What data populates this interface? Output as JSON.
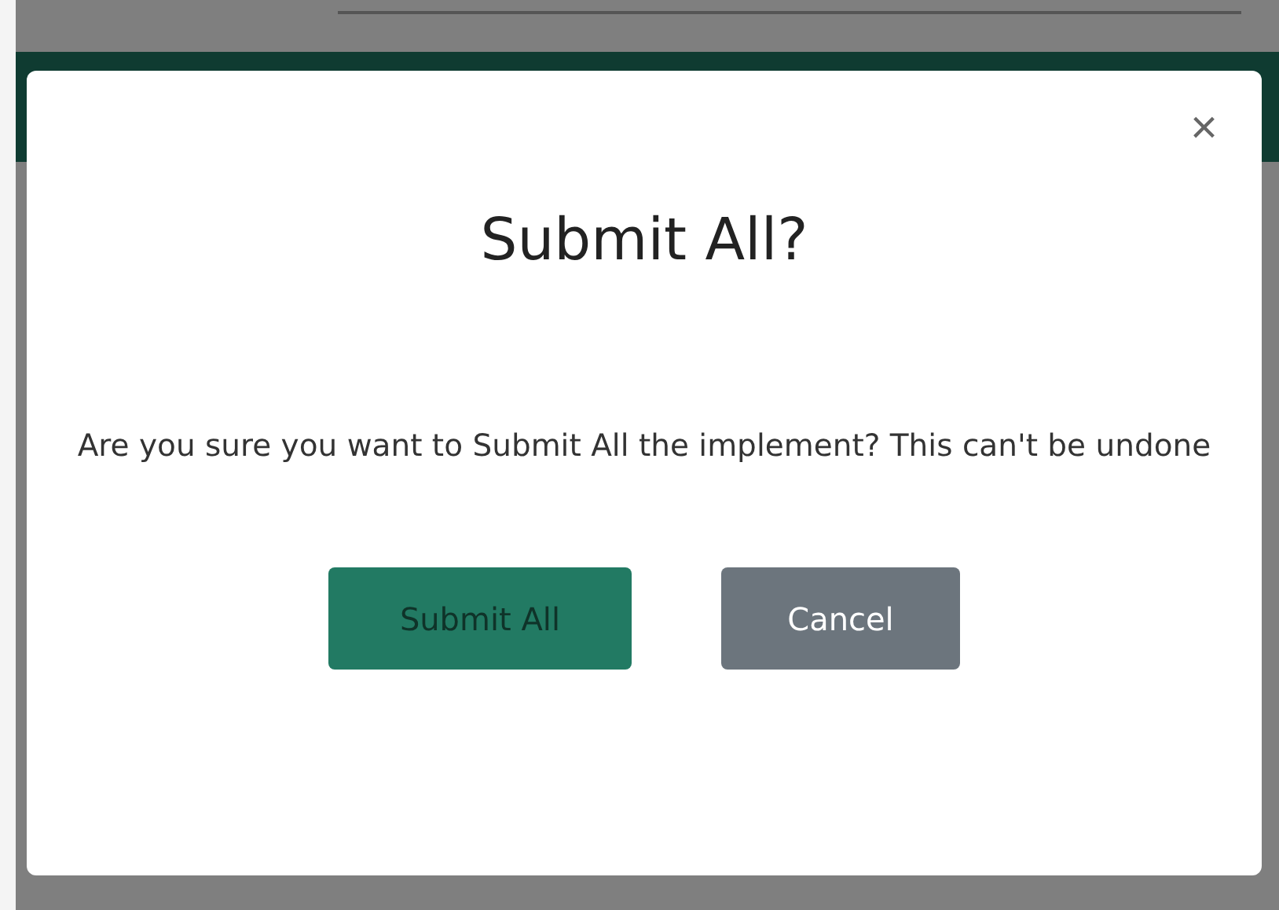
{
  "dialog": {
    "close": "×",
    "title": "Submit All?",
    "message": "Are you sure you want to Submit All the implement? This can't be undone",
    "buttons": [
      {
        "label": "Submit All",
        "kind": "primary"
      },
      {
        "label": "Cancel",
        "kind": "secondary"
      }
    ]
  }
}
